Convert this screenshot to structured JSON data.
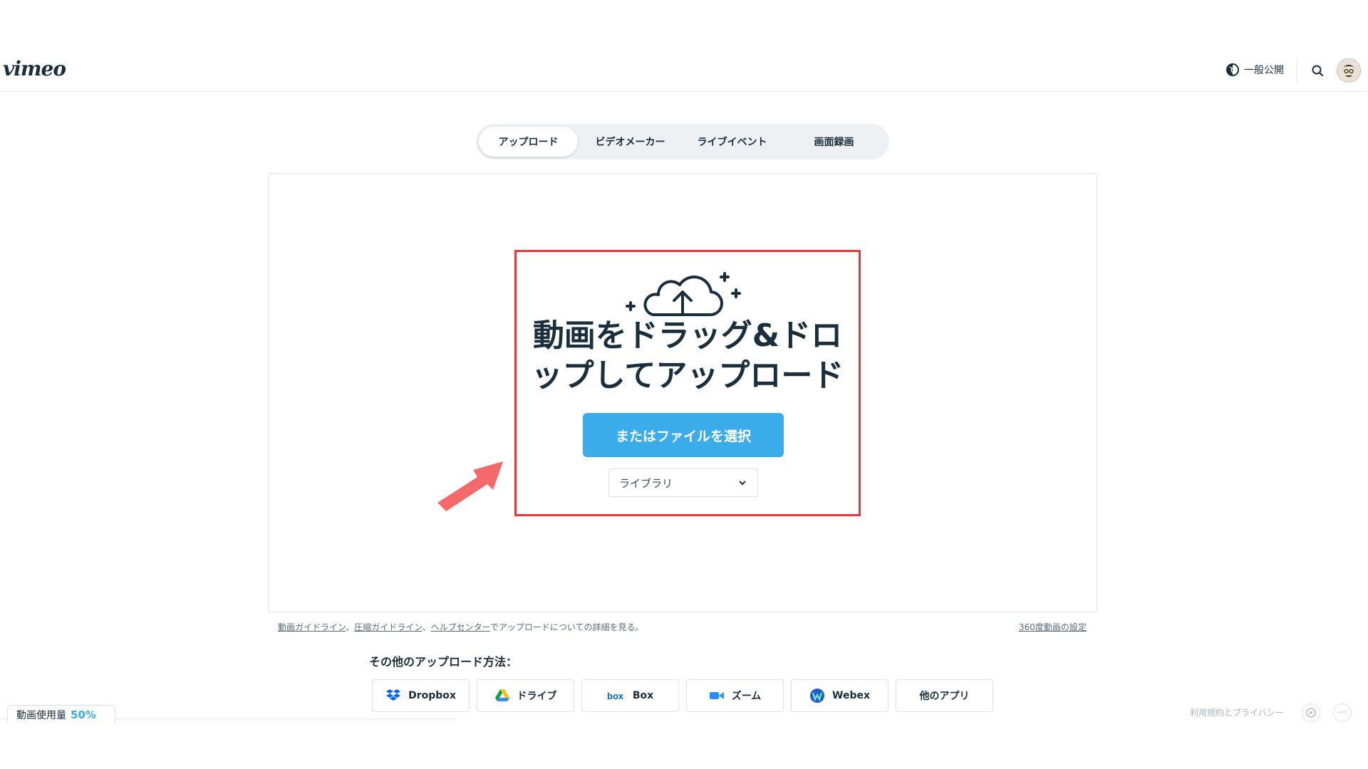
{
  "header": {
    "logo": "vimeo",
    "privacy_label": "一般公開"
  },
  "tabs": [
    {
      "label": "アップロード",
      "active": true
    },
    {
      "label": "ビデオメーカー",
      "active": false
    },
    {
      "label": "ライブイベント",
      "active": false
    },
    {
      "label": "画面録画",
      "active": false
    }
  ],
  "dropzone": {
    "headline_line1": "動画をドラッグ&ドロ",
    "headline_line2": "ップしてアップロード",
    "select_button": "またはファイルを選択",
    "folder_select": "ライブラリ"
  },
  "guide": {
    "link1": "動画ガイドライン",
    "sep1": "、",
    "link2": "圧縮ガイドライン",
    "sep2": "、",
    "link3": "ヘルプセンター",
    "suffix": "でアップロードについての詳細を見る。",
    "settings360": "360度動画の設定"
  },
  "other_methods": {
    "title": "その他のアップロード方法：",
    "apps": [
      {
        "label": "Dropbox",
        "icon": "dropbox-icon"
      },
      {
        "label": "ドライブ",
        "icon": "google-drive-icon"
      },
      {
        "label": "Box",
        "icon": "box-icon"
      },
      {
        "label": "ズーム",
        "icon": "zoom-icon"
      },
      {
        "label": "Webex",
        "icon": "webex-icon"
      },
      {
        "label": "他のアプリ",
        "icon": ""
      }
    ]
  },
  "footer": {
    "usage_label": "動画使用量",
    "usage_percent": "50%",
    "terms": "利用規約とプライバシー",
    "more": "···"
  },
  "colors": {
    "accent": "#3aacea",
    "highlight_border": "#e8383d",
    "arrow": "#f46a6a",
    "text": "#1a2e3b"
  }
}
